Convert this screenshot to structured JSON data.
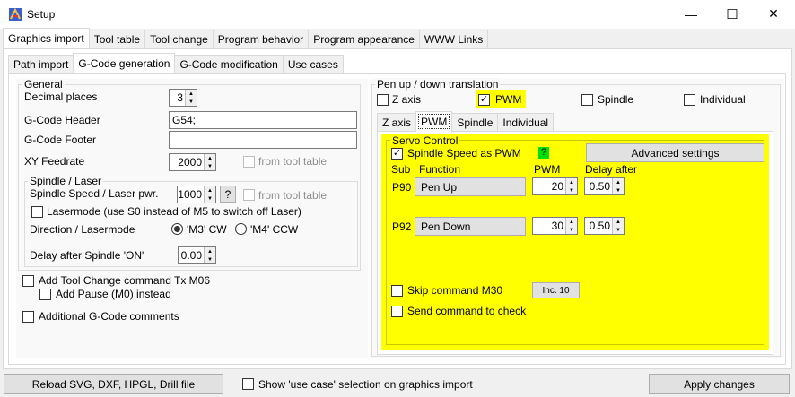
{
  "window": {
    "title": "Setup",
    "min": "—",
    "max": "☐",
    "close": "✕"
  },
  "main_tabs": [
    "Graphics import",
    "Tool table",
    "Tool change",
    "Program behavior",
    "Program appearance",
    "WWW Links"
  ],
  "sub_tabs": [
    "Path import",
    "G-Code generation",
    "G-Code modification",
    "Use cases"
  ],
  "general": {
    "title": "General",
    "decimal_places_label": "Decimal places",
    "decimal_places": "3",
    "header_label": "G-Code Header",
    "header_value": "G54;",
    "footer_label": "G-Code Footer",
    "footer_value": "",
    "feedrate_label": "XY Feedrate",
    "feedrate": "2000",
    "from_tool_table": "from tool table"
  },
  "spindle": {
    "title": "Spindle / Laser",
    "speed_label": "Spindle Speed / Laser pwr.",
    "speed": "1000",
    "help": "?",
    "from_tool_table": "from tool table",
    "lasermode": "Lasermode (use S0 instead of M5 to switch off Laser)",
    "direction_label": "Direction / Lasermode",
    "dir_cw": "'M3' CW",
    "dir_ccw": "'M4' CCW",
    "delay_label": "Delay after Spindle 'ON'",
    "delay": "0.00"
  },
  "options": {
    "tool_change": "Add Tool Change command Tx M06",
    "pause": "Add Pause (M0) instead",
    "comments": "Additional G-Code comments"
  },
  "pen": {
    "title": "Pen up / down translation",
    "z_axis": "Z axis",
    "pwm": "PWM",
    "spindle": "Spindle",
    "individual": "Individual",
    "tabs": [
      "Z axis",
      "PWM",
      "Spindle",
      "Individual"
    ]
  },
  "servo": {
    "title": "Servo Control",
    "spindle_as_pwm": "Spindle Speed as PWM",
    "help": "?",
    "advanced": "Advanced settings",
    "col_sub": "Sub",
    "col_function": "Function",
    "col_pwm": "PWM",
    "col_delay": "Delay after",
    "rows": [
      {
        "sub": "P90",
        "function": "Pen Up",
        "pwm": "20",
        "delay": "0.50"
      },
      {
        "sub": "P92",
        "function": "Pen Down",
        "pwm": "30",
        "delay": "0.50"
      }
    ],
    "skip_m30": "Skip command M30",
    "inc": "Inc. 10",
    "send_check": "Send command to check"
  },
  "bottom": {
    "reload": "Reload SVG, DXF, HPGL, Drill file",
    "show_use_case": "Show 'use case' selection on graphics import",
    "apply": "Apply changes"
  },
  "colors": {
    "highlight": "#ffff00",
    "help_green": "#00e000"
  }
}
